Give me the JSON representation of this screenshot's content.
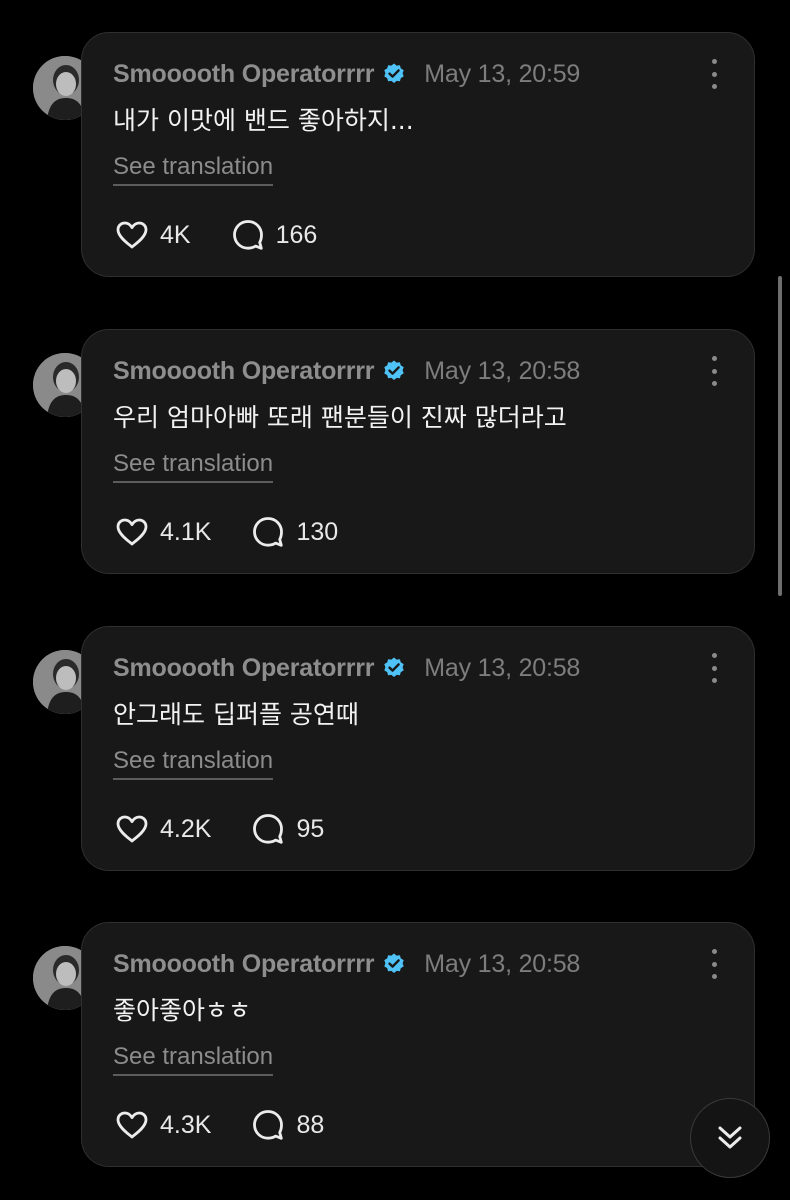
{
  "colors": {
    "background": "#000000",
    "bubble": "#181818",
    "bubble_border": "#2f2f2f",
    "verified_badge": "#4fc3f7",
    "muted_text": "#8e8e8e"
  },
  "messages": [
    {
      "username": "Smooooth Operatorrrr",
      "verified": true,
      "timestamp": "May 13, 20:59",
      "text": "내가 이맛에 밴드 좋아하지...",
      "translate_label": "See translation",
      "likes": "4K",
      "replies": "166"
    },
    {
      "username": "Smooooth Operatorrrr",
      "verified": true,
      "timestamp": "May 13, 20:58",
      "text": "우리 엄마아빠 또래 팬분들이 진짜 많더라고",
      "translate_label": "See translation",
      "likes": "4.1K",
      "replies": "130"
    },
    {
      "username": "Smooooth Operatorrrr",
      "verified": true,
      "timestamp": "May 13, 20:58",
      "text": "안그래도 딥퍼플 공연때",
      "translate_label": "See translation",
      "likes": "4.2K",
      "replies": "95"
    },
    {
      "username": "Smooooth Operatorrrr",
      "verified": true,
      "timestamp": "May 13, 20:58",
      "text": "좋아좋아ㅎㅎ",
      "translate_label": "See translation",
      "likes": "4.3K",
      "replies": "88"
    }
  ],
  "icons": {
    "like": "heart-icon",
    "reply": "speech-bubble-icon",
    "more": "three-dots-vertical-icon",
    "verified": "verified-badge-icon",
    "scroll_down": "double-chevron-down-icon"
  }
}
